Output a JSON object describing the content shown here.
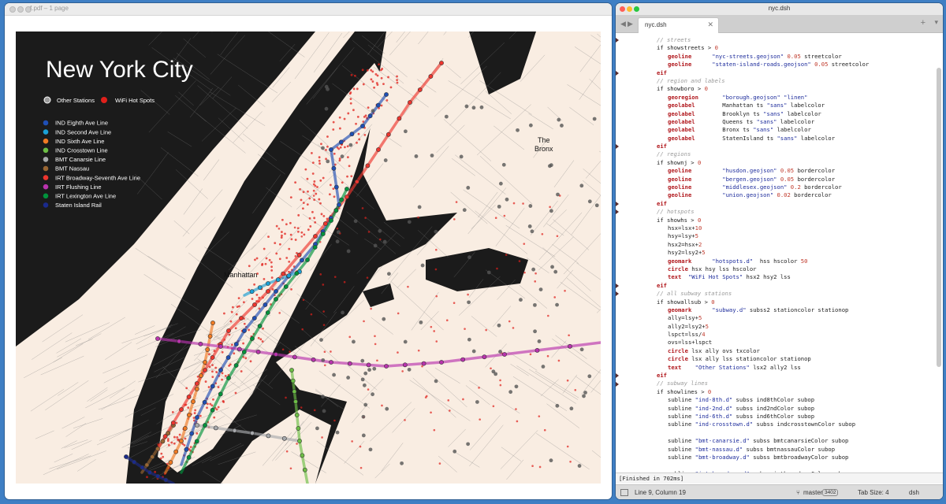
{
  "pdf_window": {
    "title": "f.pdf – 1 page"
  },
  "map": {
    "title": "New York City",
    "legend_top": [
      {
        "label": "Other Stations",
        "color": "#9a9a9a"
      },
      {
        "label": "WiFi Hot Spots",
        "color": "#e0201b"
      }
    ],
    "lines": [
      {
        "label": "IND Eighth Ave Line",
        "color": "#1f4fb5"
      },
      {
        "label": "IND Second Ave Line",
        "color": "#1aa0d6"
      },
      {
        "label": "IND Sixth Ave Line",
        "color": "#f07a23"
      },
      {
        "label": "IND Crosstown Line",
        "color": "#6cbe45"
      },
      {
        "label": "BMT Canarsie Line",
        "color": "#a7a9ac"
      },
      {
        "label": "BMT Nassau",
        "color": "#996633"
      },
      {
        "label": "IRT Broadway-Seventh Ave Line",
        "color": "#ee352e"
      },
      {
        "label": "IRT Flushing Line",
        "color": "#b933ad"
      },
      {
        "label": "IRT Lexington Ave Line",
        "color": "#00933c"
      },
      {
        "label": "Staten Island Rail",
        "color": "#1a2a8c"
      }
    ],
    "labels": {
      "manhattan": "Manhattan",
      "bronx_1": "The",
      "bronx_2": "Bronx"
    },
    "colors": {
      "background": "#1b1b1b",
      "land": "#f9ede2",
      "street": "#7b7b7b"
    }
  },
  "editor_window": {
    "title": "nyc.dsh",
    "tab_label": "nyc.dsh",
    "output": "[Finished in 702ms]",
    "status": {
      "position": "Line 9, Column 19",
      "branch": "master",
      "branch_count": "3402",
      "tab_size": "Tab Size: 4",
      "syntax": "dsh"
    }
  },
  "code": [
    {
      "i": 1,
      "t": [
        [
          "cm",
          "// streets"
        ]
      ]
    },
    {
      "i": 1,
      "t": [
        [
          "kw",
          "if showstreets > "
        ],
        [
          "nm",
          "0"
        ]
      ]
    },
    {
      "i": 2,
      "t": [
        [
          "kr",
          "geoline"
        ],
        [
          "tx",
          "      "
        ],
        [
          "st",
          "\"nyc-streets.geojson\""
        ],
        [
          "tx",
          " "
        ],
        [
          "nm",
          "0.05"
        ],
        [
          "tx",
          " streetcolor"
        ]
      ]
    },
    {
      "i": 2,
      "t": [
        [
          "kr",
          "geoline"
        ],
        [
          "tx",
          "      "
        ],
        [
          "st",
          "\"staten-island-roads.geojson\""
        ],
        [
          "tx",
          " "
        ],
        [
          "nm",
          "0.05"
        ],
        [
          "tx",
          " streetcolor"
        ]
      ]
    },
    {
      "i": 1,
      "t": [
        [
          "kr",
          "eif"
        ]
      ]
    },
    {
      "i": 1,
      "t": [
        [
          "cm",
          "// region and labels"
        ]
      ]
    },
    {
      "i": 1,
      "t": [
        [
          "kw",
          "if showboro > "
        ],
        [
          "nm",
          "0"
        ]
      ]
    },
    {
      "i": 2,
      "t": [
        [
          "kr",
          "georegion"
        ],
        [
          "tx",
          "       "
        ],
        [
          "st",
          "\"borough.geojson\""
        ],
        [
          "tx",
          " "
        ],
        [
          "st",
          "\"linen\""
        ]
      ]
    },
    {
      "i": 2,
      "t": [
        [
          "kr",
          "geolabel"
        ],
        [
          "tx",
          "        Manhattan ts "
        ],
        [
          "st",
          "\"sans\""
        ],
        [
          "tx",
          " labelcolor"
        ]
      ]
    },
    {
      "i": 2,
      "t": [
        [
          "kr",
          "geolabel"
        ],
        [
          "tx",
          "        Brooklyn ts "
        ],
        [
          "st",
          "\"sans\""
        ],
        [
          "tx",
          " labelcolor"
        ]
      ]
    },
    {
      "i": 2,
      "t": [
        [
          "kr",
          "geolabel"
        ],
        [
          "tx",
          "        Queens ts "
        ],
        [
          "st",
          "\"sans\""
        ],
        [
          "tx",
          " labelcolor"
        ]
      ]
    },
    {
      "i": 2,
      "t": [
        [
          "kr",
          "geolabel"
        ],
        [
          "tx",
          "        Bronx ts "
        ],
        [
          "st",
          "\"sans\""
        ],
        [
          "tx",
          " labelcolor"
        ]
      ]
    },
    {
      "i": 2,
      "t": [
        [
          "kr",
          "geolabel"
        ],
        [
          "tx",
          "        StatenIsland ts "
        ],
        [
          "st",
          "\"sans\""
        ],
        [
          "tx",
          " labelcolor"
        ]
      ]
    },
    {
      "i": 1,
      "t": [
        [
          "kr",
          "eif"
        ]
      ]
    },
    {
      "i": 1,
      "t": [
        [
          "cm",
          "// regions"
        ]
      ]
    },
    {
      "i": 1,
      "t": [
        [
          "kw",
          "if shownj > "
        ],
        [
          "nm",
          "0"
        ]
      ]
    },
    {
      "i": 2,
      "t": [
        [
          "kr",
          "geoline"
        ],
        [
          "tx",
          "         "
        ],
        [
          "st",
          "\"husdon.geojson\""
        ],
        [
          "tx",
          " "
        ],
        [
          "nm",
          "0.05"
        ],
        [
          "tx",
          " bordercolor"
        ]
      ]
    },
    {
      "i": 2,
      "t": [
        [
          "kr",
          "geoline"
        ],
        [
          "tx",
          "         "
        ],
        [
          "st",
          "\"bergen.geojson\""
        ],
        [
          "tx",
          " "
        ],
        [
          "nm",
          "0.05"
        ],
        [
          "tx",
          " bordercolor"
        ]
      ]
    },
    {
      "i": 2,
      "t": [
        [
          "kr",
          "geoline"
        ],
        [
          "tx",
          "         "
        ],
        [
          "st",
          "\"middlesex.geojson\""
        ],
        [
          "tx",
          " "
        ],
        [
          "nm",
          "0.2"
        ],
        [
          "tx",
          " bordercolor"
        ]
      ]
    },
    {
      "i": 2,
      "t": [
        [
          "kr",
          "geoline"
        ],
        [
          "tx",
          "         "
        ],
        [
          "st",
          "\"union.geojson\""
        ],
        [
          "tx",
          " "
        ],
        [
          "nm",
          "0.02"
        ],
        [
          "tx",
          " bordercolor"
        ]
      ]
    },
    {
      "i": 1,
      "t": [
        [
          "kr",
          "eif"
        ]
      ]
    },
    {
      "i": 1,
      "t": [
        [
          "cm",
          "// hotspots"
        ]
      ]
    },
    {
      "i": 1,
      "t": [
        [
          "kw",
          "if showhs > "
        ],
        [
          "nm",
          "0"
        ]
      ]
    },
    {
      "i": 2,
      "t": [
        [
          "tx",
          "hsx=lsx+"
        ],
        [
          "nm",
          "10"
        ]
      ]
    },
    {
      "i": 2,
      "t": [
        [
          "tx",
          "hsy=lsy+"
        ],
        [
          "nm",
          "5"
        ]
      ]
    },
    {
      "i": 2,
      "t": [
        [
          "tx",
          "hsx2=hsx+"
        ],
        [
          "nm",
          "2"
        ]
      ]
    },
    {
      "i": 2,
      "t": [
        [
          "tx",
          "hsy2=lsy2+"
        ],
        [
          "nm",
          "5"
        ]
      ]
    },
    {
      "i": 2,
      "t": [
        [
          "kr",
          "geomark"
        ],
        [
          "tx",
          "      "
        ],
        [
          "st",
          "\"hotspots.d\""
        ],
        [
          "tx",
          "  hss hscolor "
        ],
        [
          "nm",
          "50"
        ]
      ]
    },
    {
      "i": 2,
      "t": [
        [
          "kr",
          "circle"
        ],
        [
          "tx",
          " hsx hsy lss hscolor"
        ]
      ]
    },
    {
      "i": 2,
      "t": [
        [
          "kr",
          "text"
        ],
        [
          "tx",
          "  "
        ],
        [
          "st",
          "\"WiFi Hot Spots\""
        ],
        [
          "tx",
          " hsx2 hsy2 lss"
        ]
      ]
    },
    {
      "i": 1,
      "t": [
        [
          "kr",
          "eif"
        ]
      ]
    },
    {
      "i": 1,
      "t": [
        [
          "cm",
          "// all subway stations"
        ]
      ]
    },
    {
      "i": 1,
      "t": [
        [
          "kw",
          "if showallsub > "
        ],
        [
          "nm",
          "0"
        ]
      ]
    },
    {
      "i": 2,
      "t": [
        [
          "kr",
          "geomark"
        ],
        [
          "tx",
          "      "
        ],
        [
          "st",
          "\"subway.d\""
        ],
        [
          "tx",
          " subss2 stationcolor stationop"
        ]
      ]
    },
    {
      "i": 2,
      "t": [
        [
          "tx",
          "ally=lsy+"
        ],
        [
          "nm",
          "5"
        ]
      ]
    },
    {
      "i": 2,
      "t": [
        [
          "tx",
          "ally2=lsy2+"
        ],
        [
          "nm",
          "5"
        ]
      ]
    },
    {
      "i": 2,
      "t": [
        [
          "tx",
          "lspct=lss/"
        ],
        [
          "nm",
          "4"
        ]
      ]
    },
    {
      "i": 2,
      "t": [
        [
          "tx",
          "ovs=lss+lspct"
        ]
      ]
    },
    {
      "i": 2,
      "t": [
        [
          "kr",
          "circle"
        ],
        [
          "tx",
          " lsx ally ovs txcolor"
        ]
      ]
    },
    {
      "i": 2,
      "t": [
        [
          "kr",
          "circle"
        ],
        [
          "tx",
          " lsx ally lss stationcolor stationop"
        ]
      ]
    },
    {
      "i": 2,
      "t": [
        [
          "kr",
          "text"
        ],
        [
          "tx",
          "    "
        ],
        [
          "st",
          "\"Other Stations\""
        ],
        [
          "tx",
          " lsx2 ally2 lss"
        ]
      ]
    },
    {
      "i": 1,
      "t": [
        [
          "kr",
          "eif"
        ]
      ]
    },
    {
      "i": 1,
      "t": [
        [
          "cm",
          "// subway lines"
        ]
      ]
    },
    {
      "i": 1,
      "t": [
        [
          "kw",
          "if showlines > "
        ],
        [
          "nm",
          "0"
        ]
      ]
    },
    {
      "i": 2,
      "t": [
        [
          "tx",
          "subline "
        ],
        [
          "st",
          "\"ind-8th.d\""
        ],
        [
          "tx",
          " subss ind8thColor subop"
        ]
      ]
    },
    {
      "i": 2,
      "t": [
        [
          "tx",
          "subline "
        ],
        [
          "st",
          "\"ind-2nd.d\""
        ],
        [
          "tx",
          " subss ind2ndColor subop"
        ]
      ]
    },
    {
      "i": 2,
      "t": [
        [
          "tx",
          "subline "
        ],
        [
          "st",
          "\"ind-6th.d\""
        ],
        [
          "tx",
          " subss ind6thColor subop"
        ]
      ]
    },
    {
      "i": 2,
      "t": [
        [
          "tx",
          "subline "
        ],
        [
          "st",
          "\"ind-crosstown.d\""
        ],
        [
          "tx",
          " subss indcrosstownColor subop"
        ]
      ]
    },
    {
      "i": 2,
      "t": []
    },
    {
      "i": 2,
      "t": [
        [
          "tx",
          "subline "
        ],
        [
          "st",
          "\"bmt-canarsie.d\""
        ],
        [
          "tx",
          " subss bmtcanarsieColor subop"
        ]
      ]
    },
    {
      "i": 2,
      "t": [
        [
          "tx",
          "subline "
        ],
        [
          "st",
          "\"bmt-nassau.d\""
        ],
        [
          "tx",
          " subss bmtnassauColor subop"
        ]
      ]
    },
    {
      "i": 2,
      "t": [
        [
          "tx",
          "subline "
        ],
        [
          "st",
          "\"bmt-broadway.d\""
        ],
        [
          "tx",
          " subss bmtbroadwayColor subop"
        ]
      ]
    },
    {
      "i": 2,
      "t": []
    },
    {
      "i": 2,
      "t": [
        [
          "tx",
          "subline "
        ],
        [
          "st",
          "\"irt-broadway.d\""
        ],
        [
          "tx",
          " subss irtbroadwayColor subop"
        ]
      ]
    }
  ]
}
